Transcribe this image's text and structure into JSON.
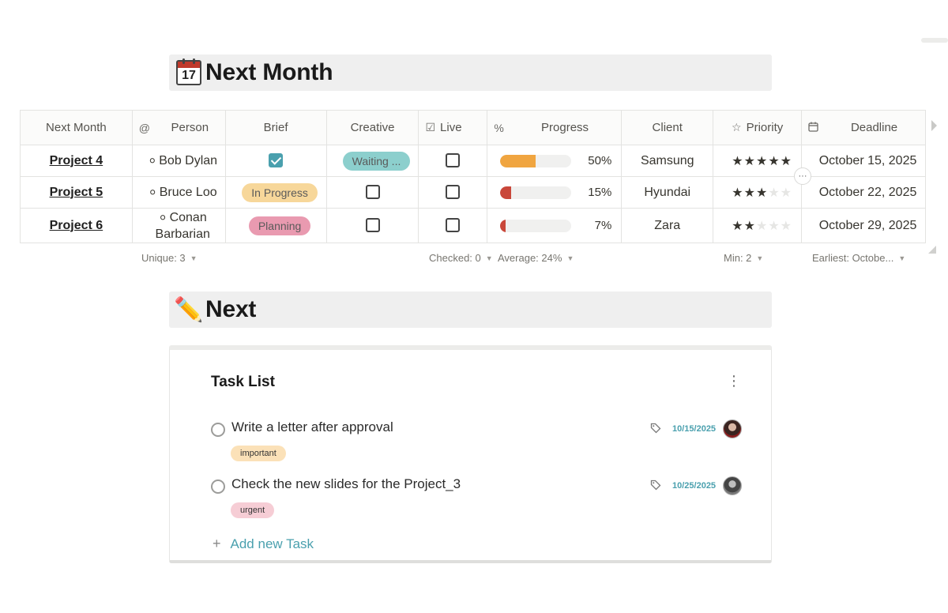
{
  "sections": {
    "next_month": {
      "emoji_number": "17",
      "title": "Next Month"
    },
    "next": {
      "emoji": "✏️",
      "title": "Next"
    }
  },
  "table": {
    "headers": {
      "name": "Next Month",
      "person": "Person",
      "brief": "Brief",
      "creative": "Creative",
      "live": "Live",
      "progress": "Progress",
      "client": "Client",
      "priority": "Priority",
      "deadline": "Deadline"
    },
    "header_icons": {
      "person": "@",
      "live": "☑",
      "progress": "%",
      "priority": "☆",
      "deadline": "calendar-icon"
    },
    "rows": [
      {
        "name": "Project 4",
        "person": "Bob Dylan",
        "brief_checked": true,
        "creative": "Waiting ...",
        "creative_color": "#8ccfcd",
        "live_checked": false,
        "progress": 0.5,
        "progress_label": "50%",
        "progress_color": "#f0a540",
        "client": "Samsung",
        "priority": 5,
        "deadline": "October 15, 2025"
      },
      {
        "name": "Project 5",
        "person": "Bruce Loo",
        "brief": "In Progress",
        "brief_color": "#f7d79a",
        "creative_checked": false,
        "live_checked": false,
        "progress": 0.15,
        "progress_label": "15%",
        "progress_color": "#c9473a",
        "client": "Hyundai",
        "priority": 3,
        "deadline": "October 22, 2025"
      },
      {
        "name": "Project 6",
        "person": "Conan Barbarian",
        "brief": "Planning",
        "brief_color": "#e99ab0",
        "creative_checked": false,
        "live_checked": false,
        "progress": 0.07,
        "progress_label": "7%",
        "progress_color": "#c9473a",
        "client": "Zara",
        "priority": 2,
        "deadline": "October 29, 2025"
      }
    ],
    "max_stars": 5,
    "footer": {
      "unique": "Unique: 3",
      "checked": "Checked: 0",
      "average": "Average: 24%",
      "min": "Min: 2",
      "earliest": "Earliest: Octobe..."
    },
    "more_label": "···"
  },
  "task_list": {
    "title": "Task List",
    "menu_icon": "⋮",
    "tasks": [
      {
        "text": "Write a letter after approval",
        "date": "10/15/2025",
        "tag": "important",
        "tag_color": "#fbe1b8"
      },
      {
        "text": "Check the new slides for the Project_3",
        "date": "10/25/2025",
        "tag": "urgent",
        "tag_color": "#f6cdd5"
      }
    ],
    "add_label": "Add new Task",
    "add_icon": "+"
  },
  "colors": {
    "accent": "#4aa0ae",
    "star": "#f0a03c"
  }
}
